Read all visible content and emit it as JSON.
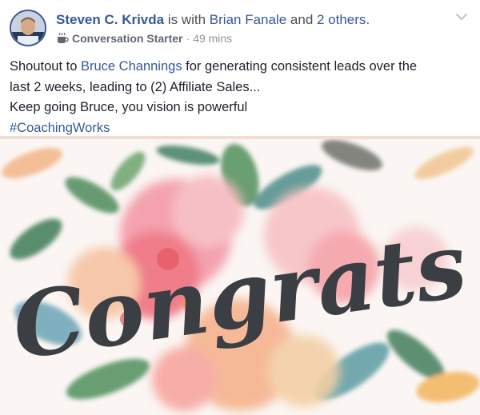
{
  "header": {
    "author": "Steven C. Krivda",
    "with_text": " is with ",
    "tagged": "Brian Fanale",
    "and_text": " and ",
    "others": "2 others",
    "period": ".",
    "badge": "Conversation Starter",
    "separator": "·",
    "time": "49 mins",
    "badge_icon": "coffee-cup-icon",
    "menu_icon": "chevron-down-icon"
  },
  "post": {
    "line1_a": "Shoutout to ",
    "mention": "Bruce Channings",
    "line1_b": " for generating consistent leads over the",
    "line2": "last 2 weeks, leading to (2) Affiliate Sales...",
    "line3": "Keep going Bruce, you vision is powerful",
    "hashtag": "#CoachingWorks"
  },
  "image": {
    "text": "Congrats",
    "colors": {
      "text": "#3b3f44",
      "pink": "#f07f8e",
      "peach": "#f6b48a",
      "green": "#5b9a5e",
      "teal": "#5aa0a6",
      "link": "#365899"
    }
  }
}
